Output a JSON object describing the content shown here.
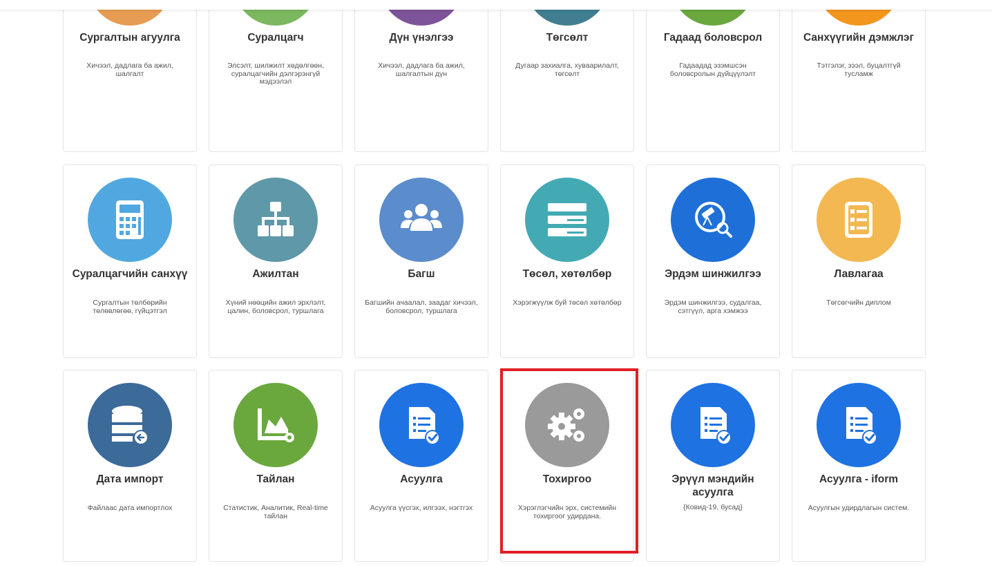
{
  "colors": {
    "highlight": "#e11e25",
    "card_border": "#e4e4e4",
    "title": "#333333",
    "description": "#555555"
  },
  "cards": [
    {
      "id": "curriculum",
      "title": "Сургалтын агуулга",
      "description": "Хичээл, дадлага ба ажил, шалгалт",
      "color": "#e69c52",
      "icon": "open-book-icon"
    },
    {
      "id": "student",
      "title": "Суралцагч",
      "description": "Элсэлт, шилжилт хөдөлгөөн, суралцагчийн дэлгэрэнгүй мэдээлэл",
      "color": "#7cb860",
      "icon": "student-icon"
    },
    {
      "id": "grades",
      "title": "Дүн үнэлгээ",
      "description": "Хичээл, дадлага ба ажил, шалгалтын дүн",
      "color": "#7d5499",
      "icon": "open-book-icon"
    },
    {
      "id": "graduation",
      "title": "Төгсөлт",
      "description": "Дугаар захиалга, хуваарилалт, төгсөлт",
      "color": "#417e91",
      "icon": "graduation-cap-icon"
    },
    {
      "id": "foreign-education",
      "title": "Гадаад боловсрол",
      "description": "Гадаадад эзэмшсэн боловсролын дүйцүүлэлт",
      "color": "#6aa83e",
      "icon": "globe-icon"
    },
    {
      "id": "financial-aid",
      "title": "Санхүүгийн дэмжлэг",
      "description": "Тэтгэлэг, зээл, буцалтгүй тусламж",
      "color": "#f3961d",
      "icon": "check-shield-icon"
    },
    {
      "id": "student-finance",
      "title": "Суралцагчийн санхүү",
      "description": "Сургалтын төлбөрийн төлөвлөгөө, гүйцэтгэл",
      "color": "#51a8e0",
      "icon": "calculator-icon"
    },
    {
      "id": "staff",
      "title": "Ажилтан",
      "description": "Хүний нөөцийн ажил эрхлэлт, цалин, боловсрол, туршлага",
      "color": "#5f98a8",
      "icon": "org-chart-icon"
    },
    {
      "id": "teacher",
      "title": "Багш",
      "description": "Багшийн ачаалал, заадаг хичээл, боловсрол, туршлага",
      "color": "#5b8ccc",
      "icon": "users-icon"
    },
    {
      "id": "programs",
      "title": "Төсөл, хөтөлбөр",
      "description": "Хэрэгжүүлж буй төсөл хөтөлбөр",
      "color": "#43aab3",
      "icon": "list-bars-icon"
    },
    {
      "id": "research",
      "title": "Эрдэм шинжилгээ",
      "description": "Эрдэм шинжилгээ, судалгаа, сэтгүүл, арга хэмжээ",
      "color": "#1e70d8",
      "icon": "telescope-search-icon"
    },
    {
      "id": "reference",
      "title": "Лавлагаа",
      "description": "Төгсөгчийн диплом",
      "color": "#f3b852",
      "icon": "list-document-icon"
    },
    {
      "id": "data-import",
      "title": "Дата импорт",
      "description": "Файлаас дата импортлох",
      "color": "#3c6a99",
      "icon": "database-import-icon"
    },
    {
      "id": "report",
      "title": "Тайлан",
      "description": "Статистик, Аналитик, Real-time тайлан",
      "color": "#6aa83e",
      "icon": "chart-gear-icon"
    },
    {
      "id": "survey",
      "title": "Асуулга",
      "description": "Асуулга үүсгэх, илгээх, нэгтгэх",
      "color": "#1f72e1",
      "icon": "survey-check-icon"
    },
    {
      "id": "settings",
      "title": "Тохиргоо",
      "description": "Хэрэглэгчийн эрх, системийн тохиргоог удирдана.",
      "color": "#9a9a9a",
      "icon": "gears-icon"
    },
    {
      "id": "health-survey",
      "title": "Эрүүл мэндийн асуулга",
      "description": "{Ковид-19, бусад}",
      "color": "#1f72e1",
      "icon": "survey-check-icon"
    },
    {
      "id": "iform-survey",
      "title": "Асуулга - iform",
      "description": "Асуулгын удирдлагын систем.",
      "color": "#1f72e1",
      "icon": "survey-check-icon"
    }
  ]
}
